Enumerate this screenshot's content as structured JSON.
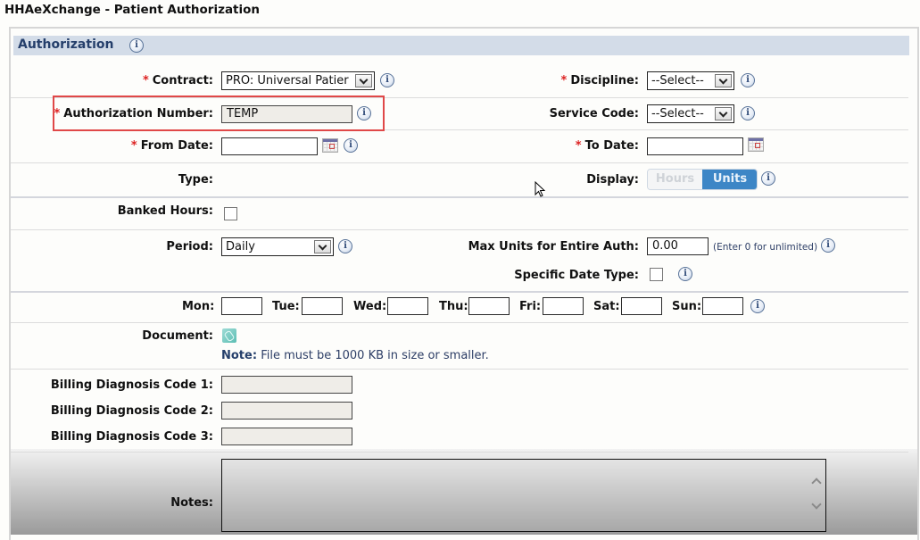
{
  "window": {
    "title": "HHAeXchange - Patient Authorization"
  },
  "section": {
    "title": "Authorization"
  },
  "fields": {
    "contract": {
      "label": "Contract:",
      "required": true,
      "value": "PRO: Universal Patier"
    },
    "authorization_number": {
      "label": "Authorization Number:",
      "required": true,
      "value": "TEMP"
    },
    "from_date": {
      "label": "From Date:",
      "required": true,
      "value": ""
    },
    "type": {
      "label": "Type:",
      "value": ""
    },
    "banked_hours": {
      "label": "Banked Hours:",
      "checked": false
    },
    "period": {
      "label": "Period:",
      "value": "Daily"
    },
    "discipline": {
      "label": "Discipline:",
      "required": true,
      "value": "--Select--"
    },
    "service_code": {
      "label": "Service Code:",
      "value": "--Select--"
    },
    "to_date": {
      "label": "To Date:",
      "required": true,
      "value": ""
    },
    "display": {
      "label": "Display:",
      "options": [
        "Hours",
        "Units"
      ],
      "selected": "Units"
    },
    "max_units": {
      "label": "Max Units for Entire Auth:",
      "value": "0.00",
      "hint": "(Enter 0 for unlimited)"
    },
    "specific_date_type": {
      "label": "Specific Date Type:",
      "checked": false
    },
    "days": [
      {
        "label": "Mon:",
        "value": ""
      },
      {
        "label": "Tue:",
        "value": ""
      },
      {
        "label": "Wed:",
        "value": ""
      },
      {
        "label": "Thu:",
        "value": ""
      },
      {
        "label": "Fri:",
        "value": ""
      },
      {
        "label": "Sat:",
        "value": ""
      },
      {
        "label": "Sun:",
        "value": ""
      }
    ],
    "document": {
      "label": "Document:",
      "note_label": "Note:",
      "note_text": "File must be 1000 KB in size or smaller."
    },
    "billing_codes": [
      {
        "label": "Billing Diagnosis Code 1:",
        "value": ""
      },
      {
        "label": "Billing Diagnosis Code 2:",
        "value": ""
      },
      {
        "label": "Billing Diagnosis Code 3:",
        "value": ""
      }
    ],
    "notes": {
      "label": "Notes:",
      "value": ""
    }
  },
  "icons": {
    "info": "i",
    "required": "*"
  },
  "colors": {
    "highlight": "#e04848",
    "toggle_active": "#3d86c6",
    "section_header": "#d3dce8",
    "required": "#dd2222"
  }
}
